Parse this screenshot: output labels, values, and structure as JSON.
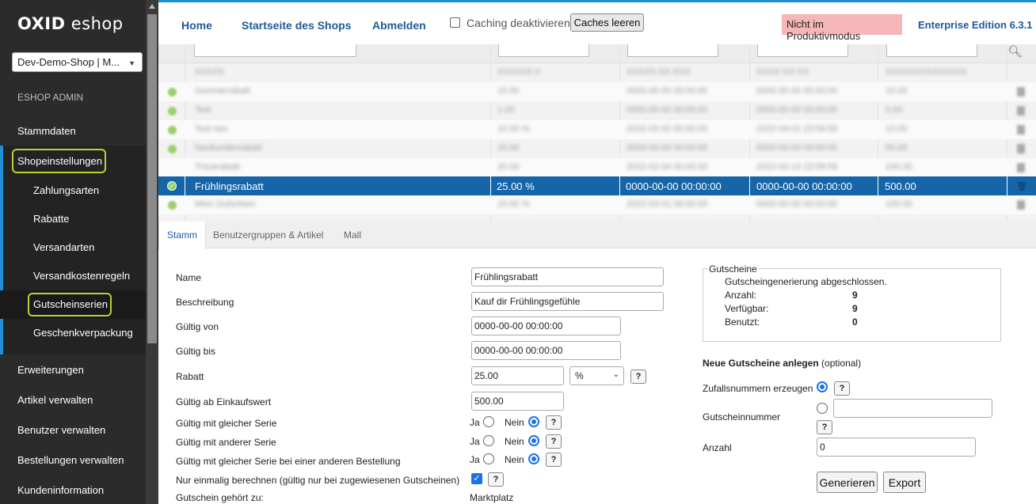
{
  "sidebar": {
    "logo_bold": "OXID",
    "logo_rest": " eshop",
    "shop_select": "Dev-Demo-Shop | M...",
    "admin_label": "ESHOP ADMIN",
    "main_items": {
      "stammdaten": "Stammdaten",
      "shopeinstellungen": "Shopeinstellungen",
      "erweiterungen": "Erweiterungen",
      "artikel": "Artikel verwalten",
      "benutzer": "Benutzer verwalten",
      "bestellungen": "Bestellungen verwalten",
      "kundeninfo": "Kundeninformation"
    },
    "sub_items": [
      "Zahlungsarten",
      "Rabatte",
      "Versandarten",
      "Versandkostenregeln",
      "Gutscheinserien",
      "Geschenkverpackung"
    ]
  },
  "topbar": {
    "home": "Home",
    "startseite": "Startseite des Shops",
    "abmelden": "Abmelden",
    "caching_label": "Caching deaktivieren",
    "caches_button": "Caches leeren",
    "prod_badge": "Nicht im Produktivmodus",
    "edition": "Enterprise Edition 6.3.1"
  },
  "list": {
    "selected_row": {
      "name": "Frühlingsrabatt",
      "discount": "25.00 %",
      "valid_from": "0000-00-00 00:00:00",
      "valid_to": "0000-00-00 00:00:00",
      "min_value": "500.00"
    },
    "blurred_rows": [
      {
        "name": "XXXXX",
        "discount": "XXXXXX.X",
        "from": "XXXXX-XX-XXX",
        "to": "XXXX-XX-XX",
        "min": "XXXXXXXXXXXXXX"
      },
      {
        "name": "Sommerrabatt",
        "discount": "15.00",
        "from": "0000-00-00 00:00:00",
        "to": "0000-00-00 00:00:00",
        "min": "10.00"
      },
      {
        "name": "Test",
        "discount": "1.00",
        "from": "0000-00-00 00:00:00",
        "to": "0000-00-00 00:00:00",
        "min": "0.00"
      },
      {
        "name": "Test neu",
        "discount": "10.00 %",
        "from": "2022-03-02 00:00:00",
        "to": "2022-04-01 23:59:59",
        "min": "10.00"
      },
      {
        "name": "Neukundenrabatt",
        "discount": "15.00",
        "from": "0000-00-00 00:00:00",
        "to": "0000-00-00 00:00:00",
        "min": "50.00"
      },
      {
        "name": "Treuerabatt",
        "discount": "20.00",
        "from": "2022-02-04 00:00:00",
        "to": "2022-02-14 23:59:59",
        "min": "100.00"
      },
      {
        "name": "Mein Gutschein",
        "discount": "15.00 %",
        "from": "2022-03-01 00:00:00",
        "to": "0000-00-00 00:00:00",
        "min": "100.00"
      }
    ]
  },
  "tabs": [
    "Stamm",
    "Benutzergruppen & Artikel",
    "Mall"
  ],
  "form": {
    "labels": {
      "name": "Name",
      "beschreibung": "Beschreibung",
      "gueltig_von": "Gültig von",
      "gueltig_bis": "Gültig bis",
      "rabatt": "Rabatt",
      "einkaufswert": "Gültig ab Einkaufswert",
      "gleiche_serie": "Gültig mit gleicher Serie",
      "andere_serie": "Gültig mit anderer Serie",
      "andere_bestellung": "Gültig mit gleicher Serie bei einer anderen Bestellung",
      "einmalig": "Nur einmalig berechnen (gültig nur bei zugewiesenen Gutscheinen)",
      "gehoert_zu": "Gutschein gehört zu:"
    },
    "values": {
      "name": "Frühlingsrabatt",
      "beschreibung": "Kauf dir Frühlingsgefühle",
      "gueltig_von": "0000-00-00 00:00:00",
      "gueltig_bis": "0000-00-00 00:00:00",
      "rabatt": "25.00",
      "rabatt_type": "%",
      "einkaufswert": "500.00",
      "gehoert_zu": "Marktplatz"
    },
    "ja": "Ja",
    "nein": "Nein",
    "help": "?"
  },
  "gutscheine": {
    "legend": "Gutscheine",
    "status": "Gutscheingenerierung abgeschlossen.",
    "anzahl_label": "Anzahl:",
    "anzahl": "9",
    "verfuegbar_label": "Verfügbar:",
    "verfuegbar": "9",
    "benutzt_label": "Benutzt:",
    "benutzt": "0"
  },
  "neue": {
    "title": "Neue Gutscheine anlegen",
    "optional": " (optional)",
    "zufall": "Zufallsnummern erzeugen",
    "nummer": "Gutscheinnummer",
    "anzahl": "Anzahl",
    "anzahl_value": "0",
    "generieren": "Generieren",
    "export": "Export"
  }
}
